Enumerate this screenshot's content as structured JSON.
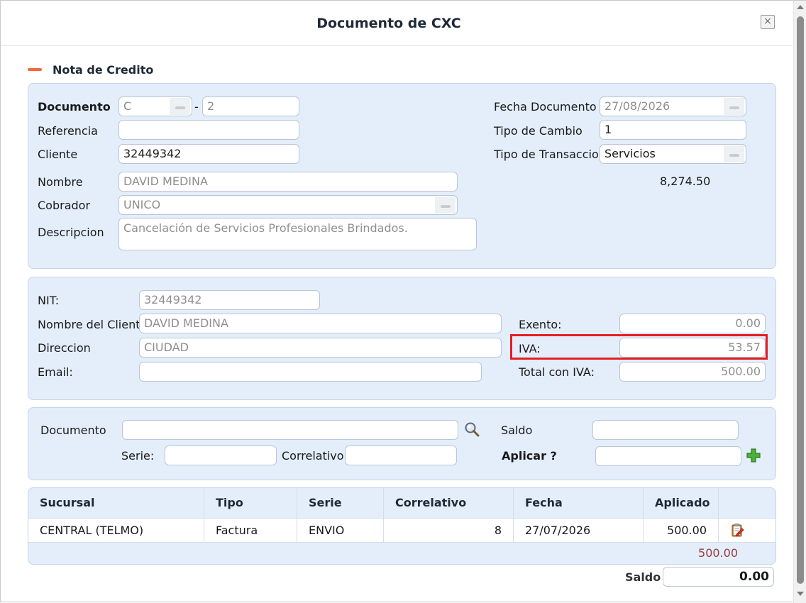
{
  "dialog": {
    "title": "Documento de CXC",
    "close_label": "×"
  },
  "section": {
    "title": "Nota de Credito"
  },
  "doc": {
    "documento_label": "Documento",
    "tipo_value": "C",
    "dash": "-",
    "numero_value": "2",
    "referencia_label": "Referencia",
    "referencia_value": "",
    "cliente_label": "Cliente",
    "cliente_value": "32449342",
    "nombre_label": "Nombre",
    "nombre_value": "DAVID MEDINA",
    "cobrador_label": "Cobrador",
    "cobrador_value": "UNICO",
    "descripcion_label": "Descripcion",
    "descripcion_value": "Cancelación de Servicios Profesionales Brindados.",
    "fecha_label": "Fecha Documento",
    "fecha_value": "27/08/2026",
    "tipo_cambio_label": "Tipo de Cambio",
    "tipo_cambio_value": "1",
    "tipo_transaccion_label": "Tipo de Transaccion",
    "tipo_transaccion_value": "Servicios",
    "monto": "8,274.50"
  },
  "facturacion": {
    "nit_label": "NIT:",
    "nit_value": "32449342",
    "nombre_cliente_label": "Nombre del Cliente",
    "nombre_cliente_value": "DAVID MEDINA",
    "direccion_label": "Direccion",
    "direccion_value": "CIUDAD",
    "email_label": "Email:",
    "email_value": "",
    "exento_label": "Exento:",
    "exento_value": "0.00",
    "iva_label": "IVA:",
    "iva_value": "53.57",
    "total_iva_label": "Total con IVA:",
    "total_iva_value": "500.00"
  },
  "aplicar": {
    "documento_label": "Documento",
    "documento_value": "",
    "serie_label": "Serie:",
    "serie_value": "",
    "correlativo_label": "Correlativo",
    "correlativo_value": "",
    "saldo_label": "Saldo",
    "saldo_value": "",
    "aplicar_label": "Aplicar ?",
    "aplicar_value": ""
  },
  "grid": {
    "columns": [
      "Sucursal",
      "Tipo",
      "Serie",
      "Correlativo",
      "Fecha",
      "Aplicado"
    ],
    "rows": [
      {
        "sucursal": "CENTRAL (TELMO)",
        "tipo": "Factura",
        "serie": "ENVIO",
        "correlativo": "8",
        "fecha": "27/07/2026",
        "aplicado": "500.00"
      }
    ],
    "total": "500.00"
  },
  "footer": {
    "saldo_label": "Saldo",
    "saldo_value": "0.00"
  },
  "colors": {
    "accent_minus": "#f06a3a",
    "panel_bg": "#e4eefa",
    "highlight": "#e31e24",
    "total_text": "#9b3b3b"
  }
}
